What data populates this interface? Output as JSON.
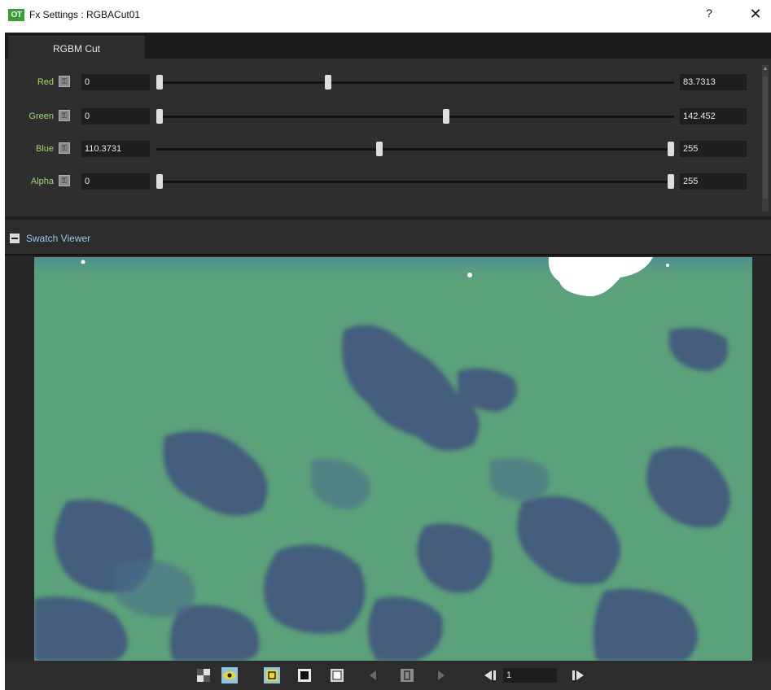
{
  "window": {
    "app_icon_text": "OT",
    "title": "Fx Settings : RGBACut01",
    "help_label": "?",
    "close_label": "✕"
  },
  "tabs": [
    {
      "label": "RGBM Cut",
      "active": true
    }
  ],
  "params": [
    {
      "label": "Red",
      "min": "0",
      "max": "83.7313",
      "min_frac": 0.0,
      "max_frac": 0.33
    },
    {
      "label": "Green",
      "min": "0",
      "max": "142.452",
      "min_frac": 0.0,
      "max_frac": 0.56
    },
    {
      "label": "Blue",
      "min": "110.3731",
      "max": "255",
      "min_frac": 0.43,
      "max_frac": 1.0
    },
    {
      "label": "Alpha",
      "min": "0",
      "max": "255",
      "min_frac": 0.0,
      "max_frac": 1.0
    }
  ],
  "swatch": {
    "title": "Swatch Viewer"
  },
  "toolbar": {
    "frame_value": "1",
    "buttons": [
      "checkerboard-icon",
      "eye-icon",
      "camera-stand-icon",
      "black-bg-icon",
      "white-bg-icon",
      "prev-key-icon",
      "key-icon",
      "next-key-icon",
      "prev-frame-icon",
      "next-frame-icon"
    ]
  },
  "colors": {
    "label_green": "#a4d86a",
    "swatch_title_blue": "#8fd0e8",
    "swatch_green": "#5ba27a",
    "swatch_blue": "#41517e",
    "toolbar_active": "#8ec4e6",
    "toolbar_yellow": "#e8d832"
  }
}
